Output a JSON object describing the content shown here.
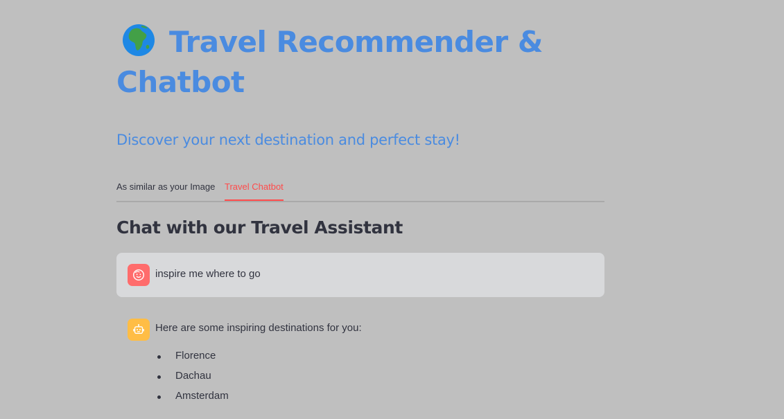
{
  "header": {
    "title": "Travel Recommender & Chatbot",
    "title_icon": "globe-africa-icon",
    "subtitle": "Discover your next destination and perfect stay!"
  },
  "tabs": [
    {
      "label": "As similar as your Image",
      "active": false
    },
    {
      "label": "Travel Chatbot",
      "active": true
    }
  ],
  "chat": {
    "heading": "Chat with our Travel Assistant",
    "messages": [
      {
        "role": "user",
        "avatar_icon": "user-face-icon",
        "text": "inspire me where to go"
      },
      {
        "role": "assistant",
        "avatar_icon": "robot-icon",
        "text": "Here are some inspiring destinations for you:",
        "items": [
          "Florence",
          "Dachau",
          "Amsterdam"
        ]
      }
    ]
  },
  "colors": {
    "background": "#bfbfbf",
    "title": "#4a8be0",
    "active_tab": "#ff4b4b",
    "user_avatar": "#ff6c6c",
    "bot_avatar": "#ffbd45",
    "user_bubble": "#d8d9db",
    "text": "#31333f"
  }
}
